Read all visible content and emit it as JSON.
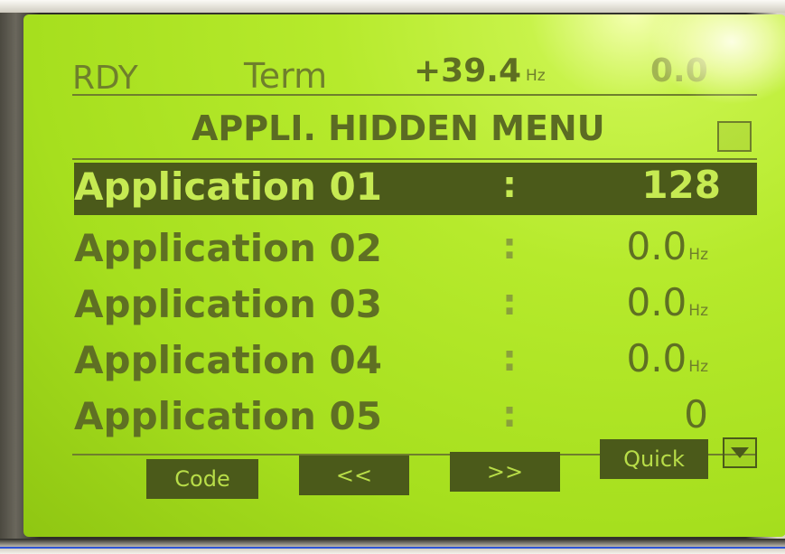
{
  "status_bar": {
    "state": "RDY",
    "mode": "Term",
    "frequency": "+39.4",
    "frequency_unit": "Hz",
    "right_value": "0.0"
  },
  "menu": {
    "title": "APPLI. HIDDEN MENU",
    "items": [
      {
        "label": "Application 01",
        "separator": ":",
        "value": "128",
        "unit": "",
        "selected": true
      },
      {
        "label": "Application 02",
        "separator": ":",
        "value": "0.0",
        "unit": "Hz",
        "selected": false
      },
      {
        "label": "Application 03",
        "separator": ":",
        "value": "0.0",
        "unit": "Hz",
        "selected": false
      },
      {
        "label": "Application 04",
        "separator": ":",
        "value": "0.0",
        "unit": "Hz",
        "selected": false
      },
      {
        "label": "Application 05",
        "separator": ":",
        "value": "0",
        "unit": "",
        "selected": false
      }
    ]
  },
  "function_keys": {
    "f1": "Code",
    "f2": "<<",
    "f3": ">>",
    "f4": "Quick"
  },
  "icons": {
    "title_box": "blank-square-icon",
    "scroll": "triangle-down-icon"
  },
  "colors": {
    "lcd_background": "#b6ea2c",
    "lcd_text": "#5b6b23",
    "selection": "#4b5a1a"
  }
}
